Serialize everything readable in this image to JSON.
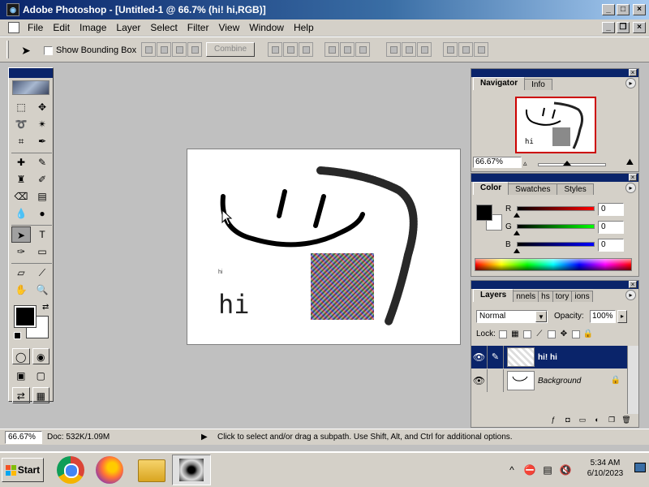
{
  "window": {
    "title": "Adobe Photoshop - [Untitled-1 @ 66.7% (hi! hi,RGB)]"
  },
  "menubar": {
    "items": [
      "File",
      "Edit",
      "Image",
      "Layer",
      "Select",
      "Filter",
      "View",
      "Window",
      "Help"
    ]
  },
  "options_bar": {
    "show_bounding_box_label": "Show Bounding Box",
    "show_bounding_box_checked": false,
    "combine_label": "Combine"
  },
  "toolbox": {
    "tools": [
      "marquee",
      "move",
      "lasso",
      "magic-wand",
      "crop",
      "slice",
      "healing",
      "brush",
      "stamp",
      "history-brush",
      "eraser",
      "gradient",
      "blur",
      "dodge",
      "path-select",
      "type",
      "pen",
      "shape",
      "notes",
      "eyedropper",
      "hand",
      "zoom"
    ],
    "selected_tool": "path-select",
    "foreground_color": "#000000",
    "background_color": "#ffffff"
  },
  "canvas": {
    "text": "hi",
    "tiny_text": "hi"
  },
  "navigator": {
    "tabs": [
      "Navigator",
      "Info"
    ],
    "active_tab": "Navigator",
    "zoom": "66.67%"
  },
  "color": {
    "tabs": [
      "Color",
      "Swatches",
      "Styles"
    ],
    "active_tab": "Color",
    "r_label": "R",
    "g_label": "G",
    "b_label": "B",
    "r_value": "0",
    "g_value": "0",
    "b_value": "0"
  },
  "layers": {
    "tabs": [
      "Layers",
      "nnels",
      "hs",
      "tory",
      "ions"
    ],
    "active_tab": "Layers",
    "blend_mode": "Normal",
    "opacity_label": "Opacity:",
    "opacity_value": "100%",
    "lock_label": "Lock:",
    "rows": [
      {
        "name": "hi! hi",
        "selected": true,
        "visible": true,
        "locked": false
      },
      {
        "name": "Background",
        "selected": false,
        "visible": true,
        "locked": true
      }
    ]
  },
  "status_bar": {
    "zoom": "66.67%",
    "doc": "Doc: 532K/1.09M",
    "message": "Click to select and/or drag a subpath. Use Shift, Alt, and Ctrl for additional options."
  },
  "taskbar": {
    "start_label": "Start",
    "time": "5:34 AM",
    "date": "6/10/2023"
  },
  "colors": {
    "titlebar": "#0a246a",
    "chrome": "#d4d0c8"
  }
}
